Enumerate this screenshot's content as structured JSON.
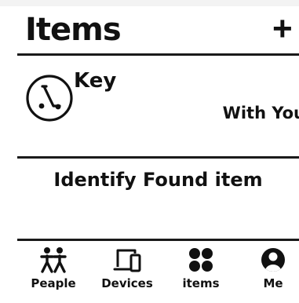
{
  "header": {
    "title": "Items",
    "add_icon": "+"
  },
  "items": [
    {
      "name": "Key",
      "icon": "scooter-icon",
      "status": "With You"
    }
  ],
  "identify": {
    "label": "Identify Found item"
  },
  "tabbar": {
    "tabs": [
      {
        "label": "Peaple",
        "icon": "people-icon"
      },
      {
        "label": "Devices",
        "icon": "devices-icon"
      },
      {
        "label": "items",
        "icon": "items-icon"
      },
      {
        "label": "Me",
        "icon": "me-icon"
      }
    ],
    "active_index": 2
  },
  "colors": {
    "background": "#ffffff",
    "foreground": "#111111",
    "top_strip": "#f3f3f3"
  }
}
